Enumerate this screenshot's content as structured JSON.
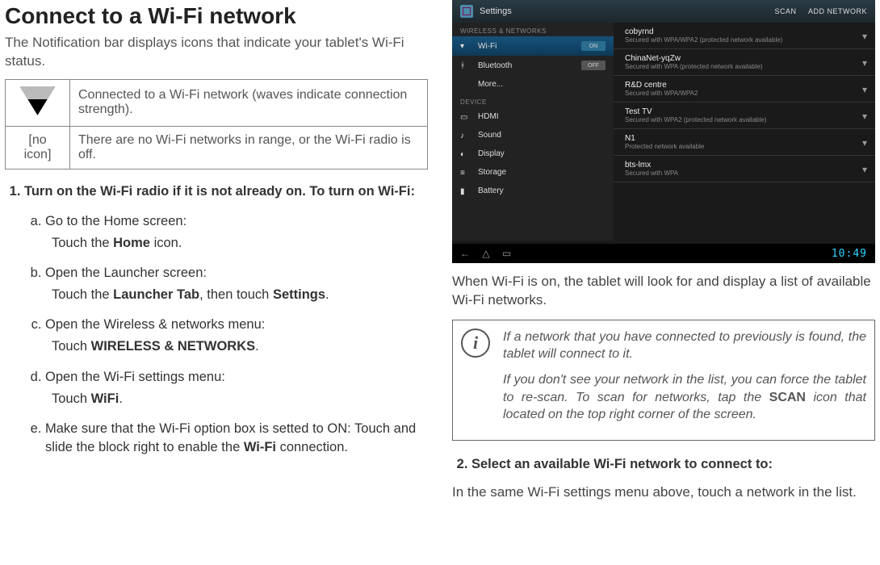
{
  "heading": "Connect to a Wi-Fi network",
  "intro": "The Notification bar displays icons that indicate your tablet's Wi-Fi status.",
  "icon_table": {
    "row1": {
      "label": "",
      "desc": "Connected to a Wi-Fi network (waves indicate connection strength)."
    },
    "row2": {
      "label": "[no icon]",
      "desc": "There are no Wi-Fi networks in range, or the Wi-Fi radio is off."
    }
  },
  "step1": {
    "title": "Turn on the Wi-Fi radio if it is not already on. To turn on Wi-Fi:",
    "a": {
      "title": "Go to the Home screen:",
      "detail_pre": "Touch the ",
      "detail_bold": "Home",
      "detail_post": " icon."
    },
    "b": {
      "title": "Open the Launcher screen:",
      "detail_pre": "Touch the ",
      "detail_b1": "Launcher Tab",
      "detail_mid": ", then touch ",
      "detail_b2": "Settings",
      "detail_post": "."
    },
    "c": {
      "title": "Open the Wireless & networks menu:",
      "detail_pre": "Touch ",
      "detail_bold": "WIRELESS & NETWORKS",
      "detail_post": "."
    },
    "d": {
      "title": "Open the Wi-Fi settings menu:",
      "detail_pre": "Touch ",
      "detail_bold": "WiFi",
      "detail_post": "."
    },
    "e": {
      "pre": "Make sure that the Wi-Fi option box is setted to ON:  Touch and slide the block right to enable the ",
      "bold": "Wi-Fi",
      "post": " connection."
    }
  },
  "step2": {
    "title": "Select an available Wi-Fi network to connect to:"
  },
  "right_para1": "When Wi-Fi is on, the tablet will look for and display a list of available Wi-Fi networks.",
  "info": {
    "p1": "If a network that you have connected to previously is found, the tablet will connect to it.",
    "p2_pre": "If you don't see your network in the list, you can force the tablet to re-scan. To scan for networks, tap the ",
    "p2_bold": "SCAN",
    "p2_post": " icon that located on the top right corner of the screen."
  },
  "right_para2": "In the same Wi-Fi settings menu above, touch a network in the list.",
  "mock": {
    "title": "Settings",
    "scan": "SCAN",
    "add": "ADD NETWORK",
    "sections": {
      "wireless": "WIRELESS & NETWORKS",
      "device": "DEVICE"
    },
    "side": {
      "wifi": "Wi-Fi",
      "wifi_toggle": "ON",
      "bt": "Bluetooth",
      "bt_toggle": "OFF",
      "more": "More...",
      "hdmi": "HDMI",
      "sound": "Sound",
      "display": "Display",
      "storage": "Storage",
      "battery": "Battery"
    },
    "networks": [
      {
        "name": "cobyrnd",
        "sec": "Secured with WPA/WPA2 (protected network available)"
      },
      {
        "name": "ChinaNet-yqZw",
        "sec": "Secured with WPA (protected network available)"
      },
      {
        "name": "R&D centre",
        "sec": "Secured with WPA/WPA2"
      },
      {
        "name": "Test TV",
        "sec": "Secured with WPA2 (protected network available)"
      },
      {
        "name": "N1",
        "sec": "Protected network available"
      },
      {
        "name": "bts-lmx",
        "sec": "Secured with WPA"
      }
    ],
    "clock": "10:49"
  }
}
